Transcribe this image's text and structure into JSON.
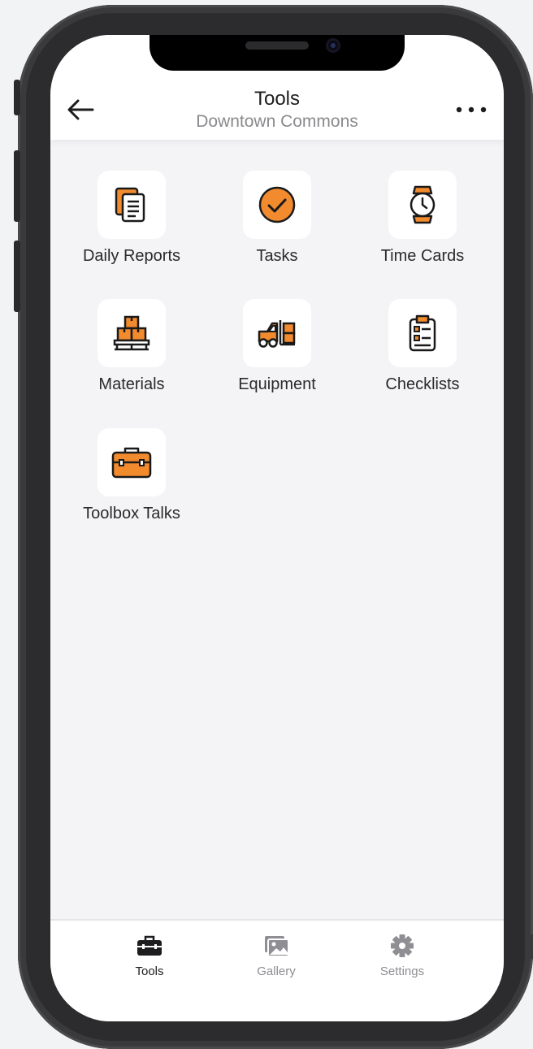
{
  "header": {
    "title": "Tools",
    "subtitle": "Downtown Commons",
    "back_icon": "arrow-left-icon",
    "more_icon": "more-horizontal-icon"
  },
  "tools": [
    {
      "label": "Daily Reports",
      "icon": "documents-icon"
    },
    {
      "label": "Tasks",
      "icon": "check-circle-icon"
    },
    {
      "label": "Time Cards",
      "icon": "wristwatch-icon"
    },
    {
      "label": "Materials",
      "icon": "stacked-boxes-icon"
    },
    {
      "label": "Equipment",
      "icon": "forklift-icon"
    },
    {
      "label": "Checklists",
      "icon": "clipboard-list-icon"
    },
    {
      "label": "Toolbox Talks",
      "icon": "toolbox-icon"
    }
  ],
  "tabbar": {
    "tabs": [
      {
        "label": "Tools",
        "icon": "toolbox-icon",
        "active": true
      },
      {
        "label": "Gallery",
        "icon": "images-icon",
        "active": false
      },
      {
        "label": "Settings",
        "icon": "gear-icon",
        "active": false
      }
    ]
  },
  "colors": {
    "accent": "#F28A2E",
    "outline": "#1A1A1A",
    "background": "#F4F4F6",
    "tab_inactive": "#8E8E93",
    "tab_active": "#1D1D1F"
  }
}
